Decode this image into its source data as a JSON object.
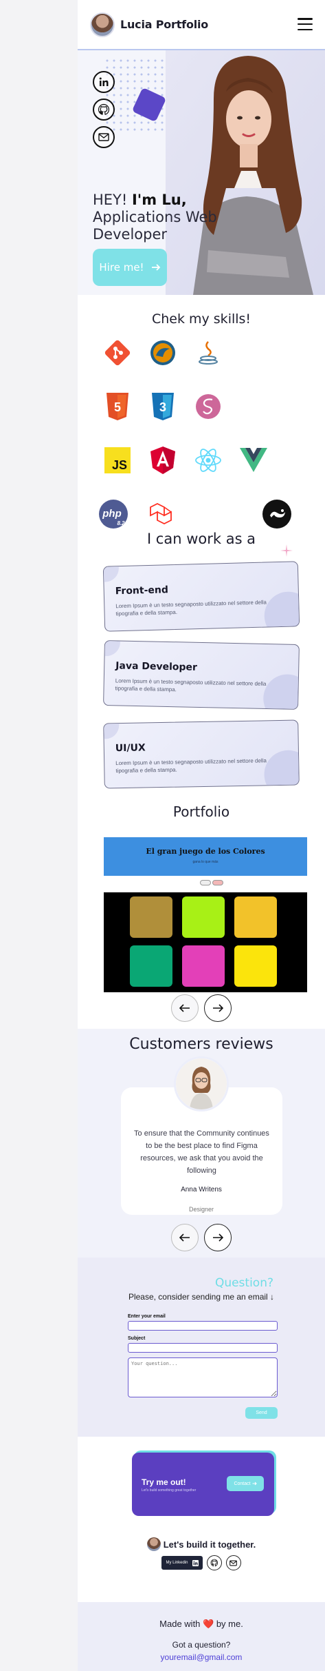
{
  "header": {
    "brand": "Lucia Portfolio"
  },
  "hero": {
    "greeting": "HEY! ",
    "name": "I'm Lu,",
    "role_line1": "Applications Web",
    "role_line2": "Developer",
    "hire_label": "Hire me!"
  },
  "skills": {
    "title": "Chek my skills!",
    "icons": [
      "git-icon",
      "mysql-icon",
      "java-icon",
      "html5-icon",
      "css3-icon",
      "sass-icon",
      "javascript-icon",
      "angular-icon",
      "react-icon",
      "vue-icon",
      "php-icon",
      "laravel-icon",
      "github-icon"
    ],
    "js_text": "JS",
    "php_text": "php",
    "php_version": "8.2"
  },
  "work": {
    "title": "I can work as a",
    "cards": [
      {
        "title": "Front-end",
        "text": "Lorem Ipsum è un testo segnaposto utilizzato nel settore della tipografia e della stampa."
      },
      {
        "title": "Java Developer",
        "text": "Lorem Ipsum è un testo segnaposto utilizzato nel settore della tipografia e della stampa."
      },
      {
        "title": "UI/UX",
        "text": "Lorem Ipsum è un testo segnaposto utilizzato nel settore della tipografia e della stampa."
      }
    ]
  },
  "portfolio": {
    "title": "Portfolio",
    "project_title": "El gran juego de los Colores",
    "project_subtitle": "gana lo que más",
    "tile_colors": [
      "#b08f3a",
      "#a8f016",
      "#f2c22a",
      "#0aa774",
      "#e340b8",
      "#fbe40c"
    ]
  },
  "reviews": {
    "title": "Customers reviews",
    "text": "To ensure that the Community continues to be the best place to find Figma resources, we ask that you avoid the following",
    "name": "Anna Writens",
    "role": "Designer"
  },
  "contact": {
    "title": "Question?",
    "subtitle": "Please, consider sending me an email ↓",
    "email_label": "Enter your email",
    "subject_label": "Subject",
    "question_placeholder": "Your question...",
    "send_label": "Send"
  },
  "cta": {
    "title": "Try me out!",
    "subtitle": "Let's build something great together",
    "button": "Contact",
    "together": "Let's build it together.",
    "linkedin_label": "My Linkedin"
  },
  "footer": {
    "made_pre": "Made with ",
    "heart": "❤️",
    "made_post": " by me.",
    "got": "Got a question?",
    "email": "youremail@gmail.com"
  },
  "colors": {
    "accent": "#7fe1e7",
    "primary": "#5b3fc0",
    "link": "#4d3fd6"
  }
}
